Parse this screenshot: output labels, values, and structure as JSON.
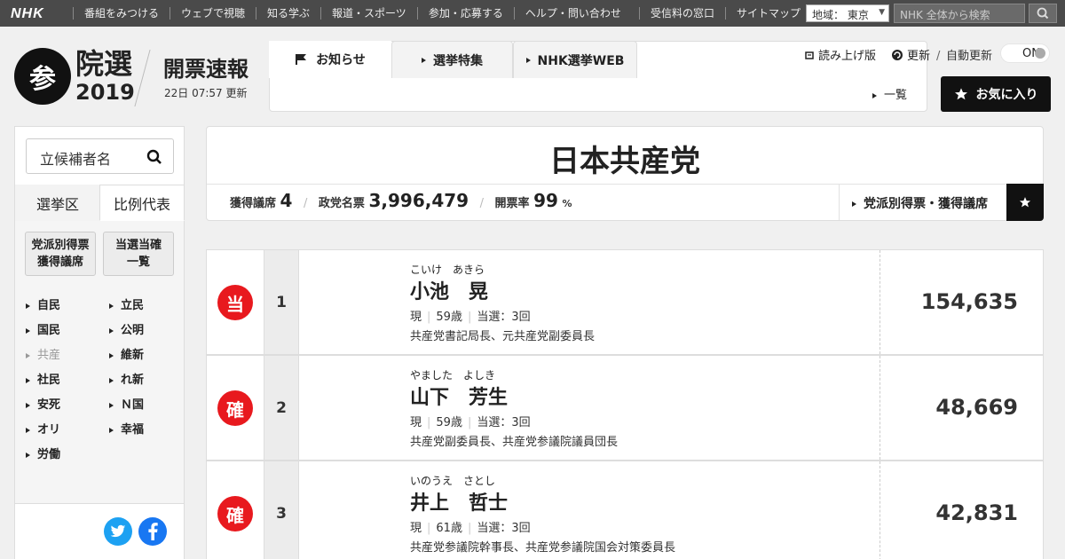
{
  "topbar": {
    "logo": "NHK",
    "nav": [
      "番組をみつける",
      "ウェブで視聴",
      "知る学ぶ",
      "報道・スポーツ",
      "参加・応募する",
      "ヘルプ・問い合わせ"
    ],
    "nav2": [
      "受信料の窓口",
      "サイトマップ"
    ],
    "region": "地域： 東京",
    "search_placeholder": "NHK 全体から検索"
  },
  "header": {
    "logo_mark": "参",
    "title": "院選",
    "year": "2019",
    "section": "開票速報",
    "updated": "22日 07:57 更新"
  },
  "tabs": [
    {
      "label": "お知らせ"
    },
    {
      "label": "選挙特集"
    },
    {
      "label": "NHK選挙WEB"
    }
  ],
  "tab_list_link": "一覧",
  "controls": {
    "read_aloud": "読み上げ版",
    "refresh": "更新",
    "auto_refresh": "自動更新",
    "toggle": "ON",
    "favorite": "お気に入り"
  },
  "sidebar": {
    "search_placeholder": "立候補者名",
    "tabs": [
      "選挙区",
      "比例代表"
    ],
    "buttons": [
      "党派別得票\n獲得議席",
      "当選当確\n一覧"
    ],
    "parties_left": [
      "自民",
      "国民",
      "共産",
      "社民",
      "安死",
      "オリ",
      "労働"
    ],
    "parties_right": [
      "立民",
      "公明",
      "維新",
      "れ新",
      "Ｎ国",
      "幸福"
    ]
  },
  "party": {
    "name": "日本共産党",
    "seats_label": "獲得議席",
    "seats": "4",
    "votes_label": "政党名票",
    "votes": "3,996,479",
    "count_rate_label": "開票率",
    "count_rate": "99",
    "count_rate_unit": "%",
    "link": "党派別得票・獲得議席"
  },
  "candidates": [
    {
      "badge": "当",
      "rank": "1",
      "kana": "こいけ　あきら",
      "name": "小池　晃",
      "status": "現",
      "age": "59歳",
      "wins": "当選：3回",
      "post": "共産党書記局長、元共産党副委員長",
      "votes": "154,635"
    },
    {
      "badge": "確",
      "rank": "2",
      "kana": "やました　よしき",
      "name": "山下　芳生",
      "status": "現",
      "age": "59歳",
      "wins": "当選：3回",
      "post": "共産党副委員長、共産党参議院議員団長",
      "votes": "48,669"
    },
    {
      "badge": "確",
      "rank": "3",
      "kana": "いのうえ　さとし",
      "name": "井上　哲士",
      "status": "現",
      "age": "61歳",
      "wins": "当選：3回",
      "post": "共産党参議院幹事長、共産党参議院国会対策委員長",
      "votes": "42,831"
    }
  ],
  "colors": {
    "badge": "#e8191e",
    "topbar": "#4a4a4a",
    "accent_dark": "#111111"
  }
}
